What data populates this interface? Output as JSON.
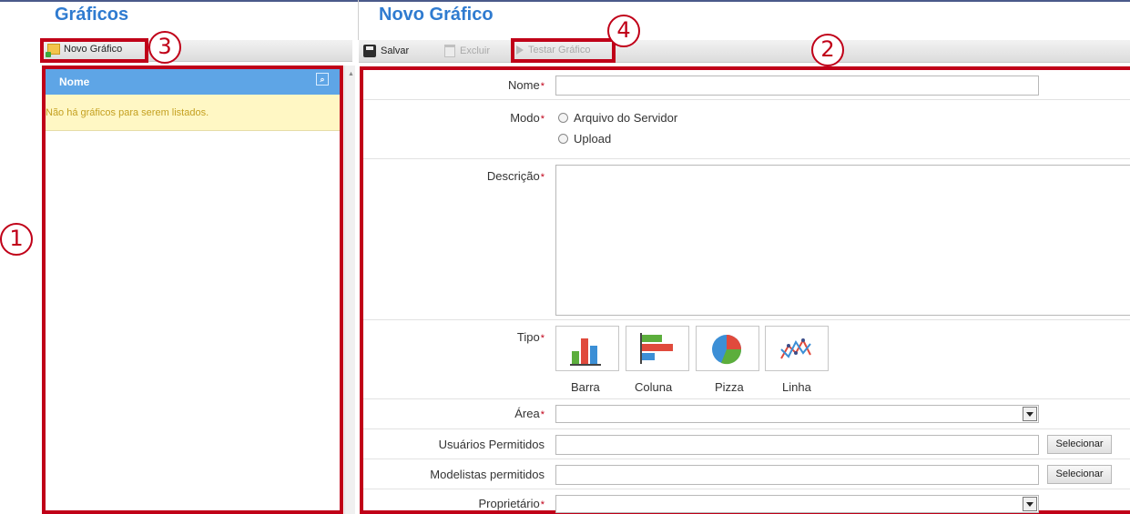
{
  "left": {
    "title": "Gráficos",
    "new_button_label": "Novo Gráfico",
    "list_header": "Nome",
    "empty_message": "Não há gráficos para serem listados."
  },
  "right": {
    "title": "Novo Gráfico",
    "toolbar": {
      "save_label": "Salvar",
      "delete_label": "Excluir",
      "test_label": "Testar Gráfico"
    },
    "form": {
      "required_marker": "*",
      "name_label": "Nome",
      "mode_label": "Modo",
      "mode_options": [
        "Arquivo do Servidor",
        "Upload"
      ],
      "description_label": "Descrição",
      "type_label": "Tipo",
      "type_options": [
        "Barra",
        "Coluna",
        "Pizza",
        "Linha"
      ],
      "area_label": "Área",
      "allowed_users_label": "Usuários Permitidos",
      "allowed_modelers_label": "Modelistas permitidos",
      "owner_label": "Proprietário",
      "select_button_label": "Selecionar"
    }
  },
  "annotations": [
    "1",
    "2",
    "3",
    "4"
  ],
  "colors": {
    "title_blue": "#2f7bd0",
    "annotation_red": "#c00018",
    "list_header_blue": "#5ea5e6",
    "empty_bg": "#fff7c4"
  }
}
